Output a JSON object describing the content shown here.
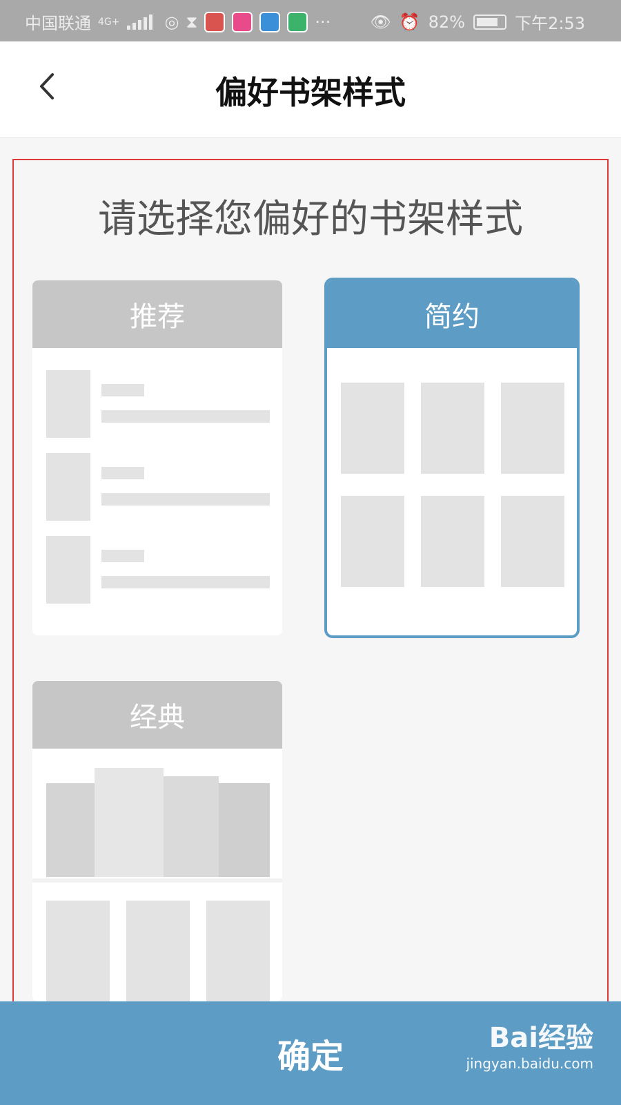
{
  "status_bar": {
    "carrier": "中国联通",
    "network": "4G+",
    "battery": "82%",
    "time": "下午2:53",
    "more": "···"
  },
  "header": {
    "title": "偏好书架样式"
  },
  "main": {
    "heading": "请选择您偏好的书架样式",
    "options": [
      {
        "label": "推荐",
        "selected": false
      },
      {
        "label": "简约",
        "selected": true
      },
      {
        "label": "经典",
        "selected": false
      }
    ]
  },
  "footer": {
    "confirm_label": "确定"
  },
  "watermark": {
    "brand": "Bai经验",
    "url": "jingyan.baidu.com"
  },
  "colors": {
    "accent": "#5d9cc4",
    "header_gray": "#c6c6c6",
    "status_bar": "#a9a9a9",
    "frame_red": "#e03a3a"
  }
}
